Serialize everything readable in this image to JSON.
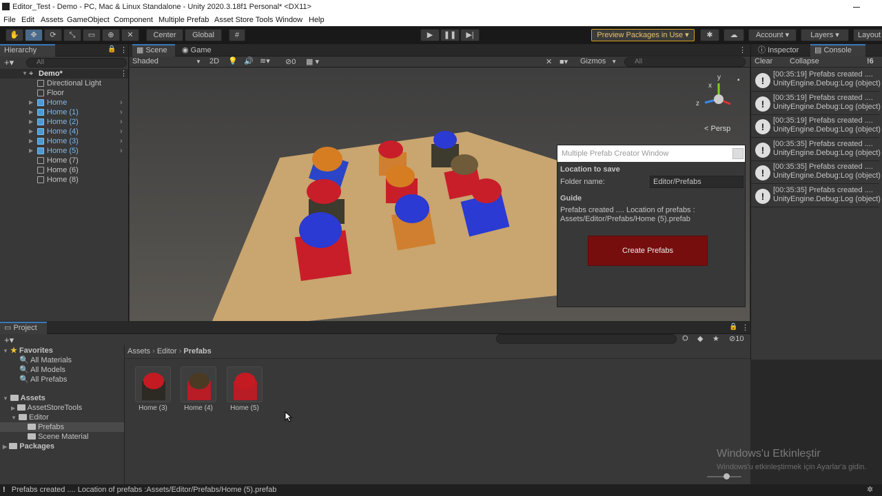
{
  "window": {
    "title": "Editor_Test - Demo - PC, Mac & Linux Standalone - Unity 2020.3.18f1 Personal* <DX11>"
  },
  "menu": [
    "File",
    "Edit",
    "Assets",
    "GameObject",
    "Component",
    "Multiple Prefab",
    "Asset Store Tools",
    "Window",
    "Help"
  ],
  "toolbar": {
    "center": "Center",
    "global": "Global",
    "preview": "Preview Packages in Use ▾",
    "account": "Account",
    "layers": "Layers",
    "layout": "Layout"
  },
  "hierarchy": {
    "tab": "Hierarchy",
    "search": "All",
    "scene": "Demo*",
    "items": [
      {
        "label": "Directional Light",
        "prefab": false
      },
      {
        "label": "Floor",
        "prefab": false
      },
      {
        "label": "Home",
        "prefab": true
      },
      {
        "label": "Home (1)",
        "prefab": true
      },
      {
        "label": "Home (2)",
        "prefab": true
      },
      {
        "label": "Home (4)",
        "prefab": true
      },
      {
        "label": "Home (3)",
        "prefab": true
      },
      {
        "label": "Home (5)",
        "prefab": true
      },
      {
        "label": "Home (7)",
        "prefab": false
      },
      {
        "label": "Home (6)",
        "prefab": false
      },
      {
        "label": "Home (8)",
        "prefab": false
      }
    ]
  },
  "scene": {
    "tab_scene": "Scene",
    "tab_game": "Game",
    "shading": "Shaded",
    "mode2d": "2D",
    "hidden_count": "0",
    "gizmos": "Gizmos",
    "search": "All",
    "persp": "< Persp",
    "axis_x": "x",
    "axis_y": "y",
    "axis_z": "z"
  },
  "creator": {
    "title": "Multiple Prefab Creator Window",
    "section_save": "Location to save",
    "folder_label": "Folder name:",
    "folder_value": "Editor/Prefabs",
    "guide": "Guide",
    "guide_text": "Prefabs created ....  Location of prefabs : Assets/Editor/Prefabs/Home (5).prefab",
    "button": "Create Prefabs"
  },
  "inspector": {
    "tab_inspector": "Inspector",
    "tab_console": "Console",
    "clear": "Clear",
    "collapse": "Collapse",
    "count": "6",
    "logs": [
      {
        "l1": "[00:35:19] Prefabs created ....",
        "l2": "UnityEngine.Debug:Log (object)"
      },
      {
        "l1": "[00:35:19] Prefabs created ....",
        "l2": "UnityEngine.Debug:Log (object)"
      },
      {
        "l1": "[00:35:19] Prefabs created ....",
        "l2": "UnityEngine.Debug:Log (object)"
      },
      {
        "l1": "[00:35:35] Prefabs created ....",
        "l2": "UnityEngine.Debug:Log (object)"
      },
      {
        "l1": "[00:35:35] Prefabs created ....",
        "l2": "UnityEngine.Debug:Log (object)"
      },
      {
        "l1": "[00:35:35] Prefabs created ....",
        "l2": "UnityEngine.Debug:Log (object)"
      }
    ]
  },
  "project": {
    "tab": "Project",
    "hidden": "10",
    "favorites": "Favorites",
    "fav_items": [
      "All Materials",
      "All Models",
      "All Prefabs"
    ],
    "assets": "Assets",
    "asset_items": [
      "AssetStoreTools",
      "Editor"
    ],
    "editor_items": [
      "Prefabs",
      "Scene Material"
    ],
    "packages": "Packages",
    "breadcrumb": [
      "Assets",
      "Editor",
      "Prefabs"
    ],
    "thumbs": [
      {
        "label": "Home (3)",
        "box": "#2c2a22",
        "ball": "#c41a22"
      },
      {
        "label": "Home (4)",
        "box": "#b81c24",
        "ball": "#4a3a24"
      },
      {
        "label": "Home (5)",
        "box": "#b81c24",
        "ball": "#c41a22"
      }
    ]
  },
  "watermark": {
    "l1": "Windows'u Etkinleştir",
    "l2": "Windows'u etkinleştirmek için Ayarlar'a gidin."
  },
  "status": "Prefabs created ....   Location of prefabs :Assets/Editor/Prefabs/Home (5).prefab"
}
